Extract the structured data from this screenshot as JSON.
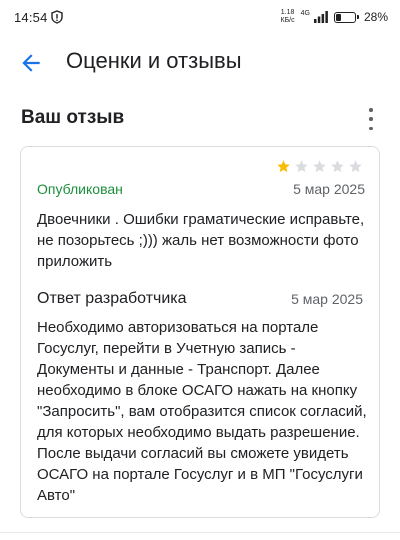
{
  "status_bar": {
    "time": "14:54",
    "net_speed_value": "1.18",
    "net_speed_unit": "КБ/с",
    "network": "4G",
    "battery_percent_text": "28%",
    "battery_level": 0.28
  },
  "app_bar": {
    "title": "Оценки и отзывы",
    "back_icon": "arrow-back-icon"
  },
  "section": {
    "title": "Ваш отзыв",
    "menu_icon": "more-vert-icon"
  },
  "review": {
    "rating": 1,
    "rating_max": 5,
    "star_filled_color": "#fbbc04",
    "star_empty_color": "#dadce0",
    "status": "Опубликован",
    "status_color": "#1e8e3e",
    "date": "5 мар 2025",
    "text": "Двоечники . Ошибки граматические исправьте, не позорьтесь ;))) жаль нет возможности фото приложить"
  },
  "developer_reply": {
    "title": "Ответ разработчика",
    "date": "5 мар 2025",
    "text": "Необходимо авторизоваться на портале Госуслуг, перейти в Учетную запись - Документы и данные - Транспорт. Далее необходимо в блоке ОСАГО нажать на кнопку \"Запросить\", вам отобразится список согласий, для которых необходимо выдать разрешение. После выдачи согласий вы сможете увидеть ОСАГО на портале Госуслуг и в МП \"Госуслуги Авто\""
  },
  "colors": {
    "accent": "#1a73e8"
  }
}
